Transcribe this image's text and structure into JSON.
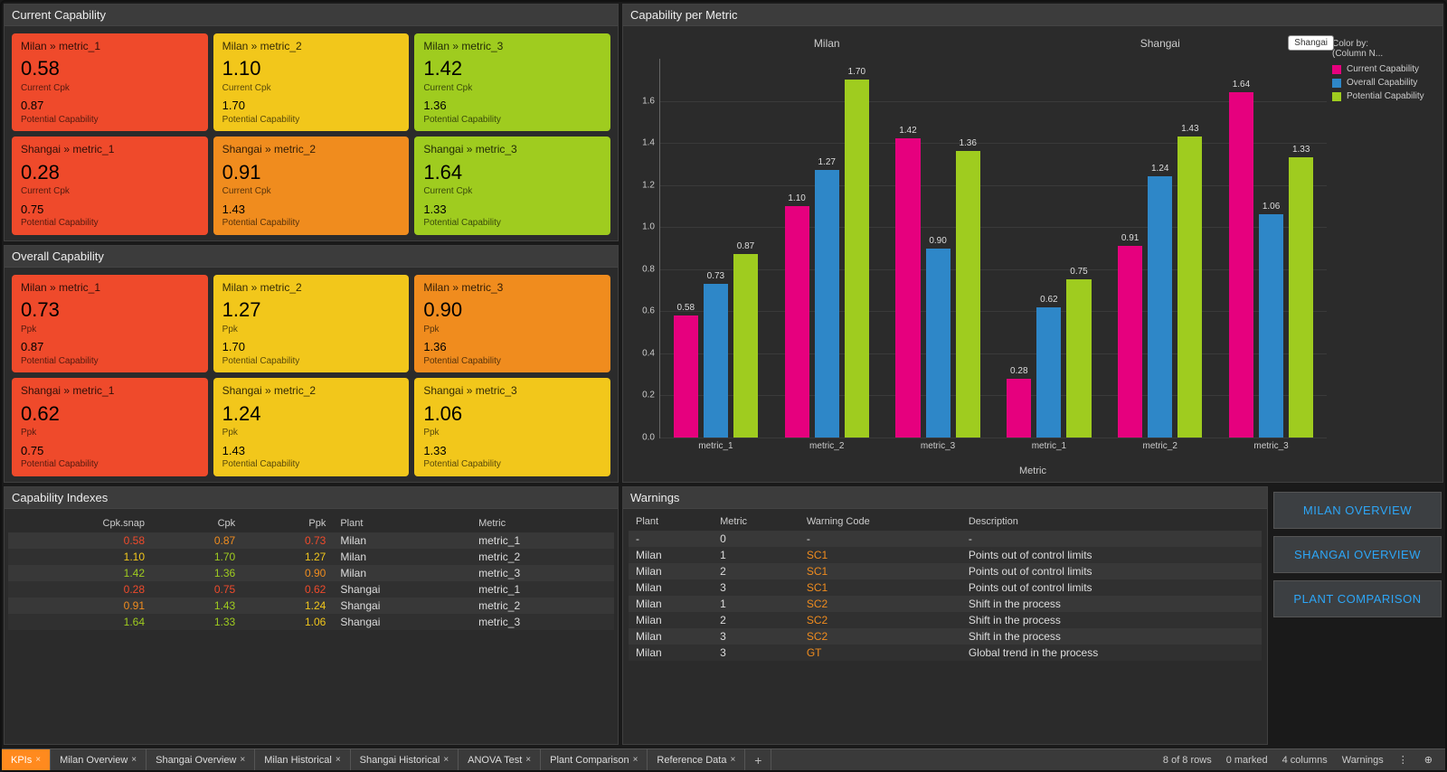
{
  "panels": {
    "current_title": "Current Capability",
    "overall_title": "Overall Capability",
    "indexes_title": "Capability Indexes",
    "chart_title": "Capability per Metric",
    "warnings_title": "Warnings"
  },
  "colors": {
    "red": "#ef4a2b",
    "orange": "#f08c1e",
    "yellow": "#f2c71b",
    "green": "#9fcc1f",
    "pink": "#e6007e",
    "blue": "#2e87c8",
    "lime": "#9fcc1f"
  },
  "current_cards": [
    {
      "crumb": "Milan » metric_1",
      "v": "0.58",
      "sub": "Current Cpk",
      "v2": "0.87",
      "sub2": "Potential Capability",
      "color": "red"
    },
    {
      "crumb": "Milan » metric_2",
      "v": "1.10",
      "sub": "Current Cpk",
      "v2": "1.70",
      "sub2": "Potential Capability",
      "color": "yellow"
    },
    {
      "crumb": "Milan » metric_3",
      "v": "1.42",
      "sub": "Current Cpk",
      "v2": "1.36",
      "sub2": "Potential Capability",
      "color": "green"
    },
    {
      "crumb": "Shangai » metric_1",
      "v": "0.28",
      "sub": "Current Cpk",
      "v2": "0.75",
      "sub2": "Potential Capability",
      "color": "red"
    },
    {
      "crumb": "Shangai » metric_2",
      "v": "0.91",
      "sub": "Current Cpk",
      "v2": "1.43",
      "sub2": "Potential Capability",
      "color": "orange"
    },
    {
      "crumb": "Shangai » metric_3",
      "v": "1.64",
      "sub": "Current Cpk",
      "v2": "1.33",
      "sub2": "Potential Capability",
      "color": "green"
    }
  ],
  "overall_cards": [
    {
      "crumb": "Milan » metric_1",
      "v": "0.73",
      "sub": "Ppk",
      "v2": "0.87",
      "sub2": "Potential Capability",
      "color": "red"
    },
    {
      "crumb": "Milan » metric_2",
      "v": "1.27",
      "sub": "Ppk",
      "v2": "1.70",
      "sub2": "Potential Capability",
      "color": "yellow"
    },
    {
      "crumb": "Milan » metric_3",
      "v": "0.90",
      "sub": "Ppk",
      "v2": "1.36",
      "sub2": "Potential Capability",
      "color": "orange"
    },
    {
      "crumb": "Shangai » metric_1",
      "v": "0.62",
      "sub": "Ppk",
      "v2": "0.75",
      "sub2": "Potential Capability",
      "color": "red"
    },
    {
      "crumb": "Shangai » metric_2",
      "v": "1.24",
      "sub": "Ppk",
      "v2": "1.43",
      "sub2": "Potential Capability",
      "color": "yellow"
    },
    {
      "crumb": "Shangai » metric_3",
      "v": "1.06",
      "sub": "Ppk",
      "v2": "1.33",
      "sub2": "Potential Capability",
      "color": "yellow"
    }
  ],
  "indexes": {
    "headers": [
      "Cpk.snap",
      "Cpk",
      "Ppk",
      "Plant",
      "Metric"
    ],
    "rows": [
      {
        "cpk_snap": "0.58",
        "c1": "red",
        "cpk": "0.87",
        "c2": "orange",
        "ppk": "0.73",
        "c3": "red",
        "plant": "Milan",
        "metric": "metric_1"
      },
      {
        "cpk_snap": "1.10",
        "c1": "yellow",
        "cpk": "1.70",
        "c2": "green",
        "ppk": "1.27",
        "c3": "yellow",
        "plant": "Milan",
        "metric": "metric_2"
      },
      {
        "cpk_snap": "1.42",
        "c1": "green",
        "cpk": "1.36",
        "c2": "green",
        "ppk": "0.90",
        "c3": "orange",
        "plant": "Milan",
        "metric": "metric_3"
      },
      {
        "cpk_snap": "0.28",
        "c1": "red",
        "cpk": "0.75",
        "c2": "red",
        "ppk": "0.62",
        "c3": "red",
        "plant": "Shangai",
        "metric": "metric_1"
      },
      {
        "cpk_snap": "0.91",
        "c1": "orange",
        "cpk": "1.43",
        "c2": "green",
        "ppk": "1.24",
        "c3": "yellow",
        "plant": "Shangai",
        "metric": "metric_2"
      },
      {
        "cpk_snap": "1.64",
        "c1": "green",
        "cpk": "1.33",
        "c2": "green",
        "ppk": "1.06",
        "c3": "yellow",
        "plant": "Shangai",
        "metric": "metric_3"
      }
    ]
  },
  "warnings": {
    "headers": [
      "Plant",
      "Metric",
      "Warning Code",
      "Description"
    ],
    "rows": [
      {
        "plant": "-",
        "metric": "0",
        "code": "-",
        "desc": "-",
        "cc": ""
      },
      {
        "plant": "Milan",
        "metric": "1",
        "code": "SC1",
        "desc": "Points out of control limits",
        "cc": "orange"
      },
      {
        "plant": "Milan",
        "metric": "2",
        "code": "SC1",
        "desc": "Points out of control limits",
        "cc": "orange"
      },
      {
        "plant": "Milan",
        "metric": "3",
        "code": "SC1",
        "desc": "Points out of control limits",
        "cc": "orange"
      },
      {
        "plant": "Milan",
        "metric": "1",
        "code": "SC2",
        "desc": "Shift in the process",
        "cc": "orange"
      },
      {
        "plant": "Milan",
        "metric": "2",
        "code": "SC2",
        "desc": "Shift in the process",
        "cc": "orange"
      },
      {
        "plant": "Milan",
        "metric": "3",
        "code": "SC2",
        "desc": "Shift in the process",
        "cc": "orange"
      },
      {
        "plant": "Milan",
        "metric": "3",
        "code": "GT",
        "desc": "Global trend in the process",
        "cc": "orange"
      }
    ]
  },
  "links": {
    "milan": "MILAN OVERVIEW",
    "shangai": "SHANGAI OVERVIEW",
    "compare": "PLANT COMPARISON"
  },
  "chart_data": {
    "type": "bar",
    "title": "Capability per Metric",
    "xlabel": "Metric",
    "ylabel": "",
    "ylim": [
      0,
      1.8
    ],
    "yticks": [
      0,
      0.2,
      0.4,
      0.6,
      0.8,
      1.0,
      1.2,
      1.4,
      1.6
    ],
    "facets": [
      "Milan",
      "Shangai"
    ],
    "categories": [
      "metric_1",
      "metric_2",
      "metric_3"
    ],
    "series": [
      {
        "name": "Current Capability",
        "color": "pink",
        "values": {
          "Milan": [
            0.58,
            1.1,
            1.42
          ],
          "Shangai": [
            0.28,
            0.91,
            1.64
          ]
        }
      },
      {
        "name": "Overall Capability",
        "color": "blue",
        "values": {
          "Milan": [
            0.73,
            1.27,
            0.9
          ],
          "Shangai": [
            0.62,
            1.24,
            1.06
          ]
        }
      },
      {
        "name": "Potential Capability",
        "color": "lime",
        "values": {
          "Milan": [
            0.87,
            1.7,
            1.36
          ],
          "Shangai": [
            0.75,
            1.43,
            1.33
          ]
        }
      }
    ],
    "legend_title": "Color by:",
    "legend_sub": "(Column N...",
    "tooltip": "Shangai"
  },
  "tabs": [
    "KPIs",
    "Milan Overview",
    "Shangai Overview",
    "Milan Historical",
    "Shangai Historical",
    "ANOVA Test",
    "Plant Comparison",
    "Reference Data"
  ],
  "active_tab": "KPIs",
  "status": {
    "rows": "8 of 8 rows",
    "marked": "0 marked",
    "cols": "4 columns",
    "filter": "Warnings"
  }
}
